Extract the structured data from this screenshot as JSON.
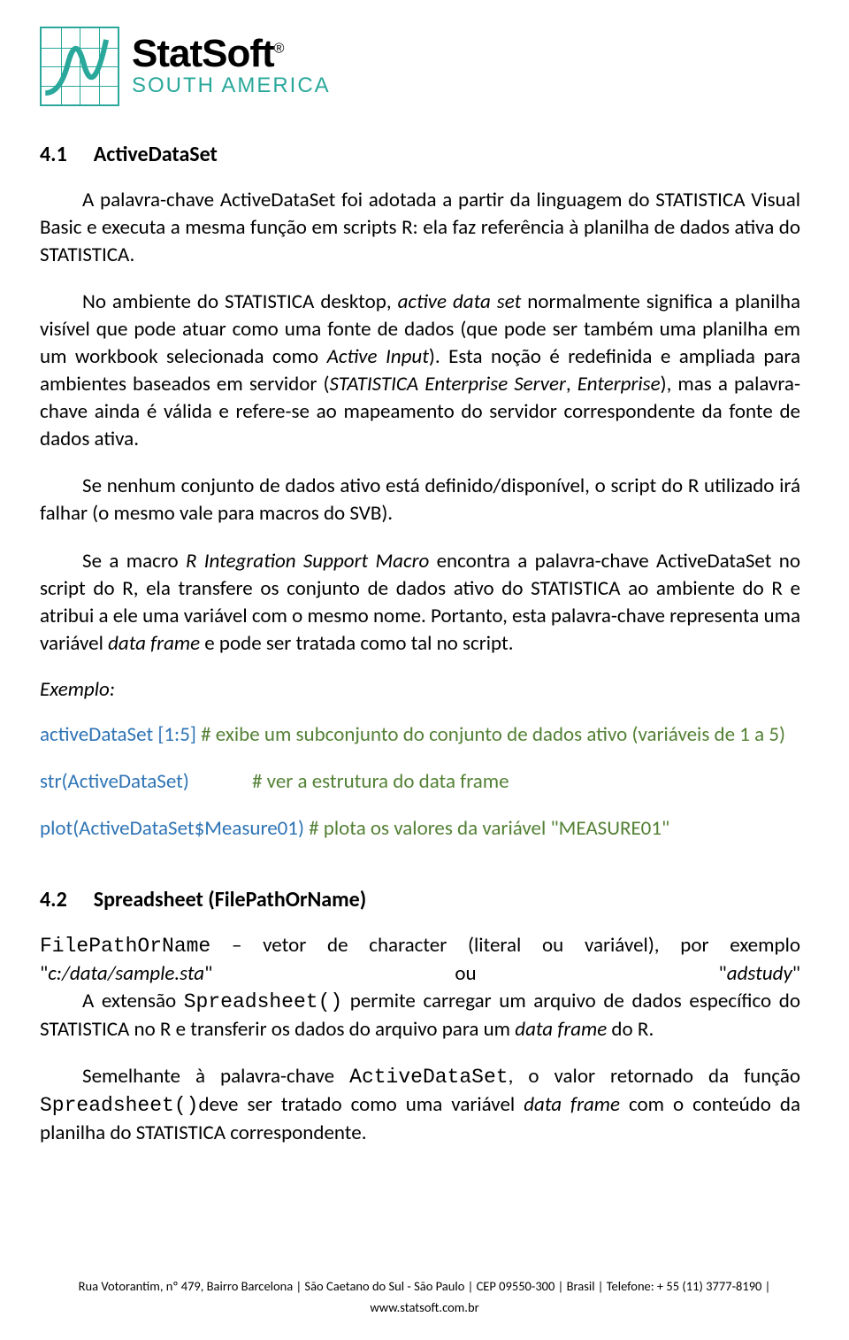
{
  "logo": {
    "brand": "StatSoft",
    "reg": "®",
    "subtitle": "SOUTH AMERICA"
  },
  "section1": {
    "number": "4.1",
    "title": "ActiveDataSet",
    "para1": "A palavra-chave ActiveDataSet foi adotada a partir da linguagem do STATISTICA Visual Basic e executa a mesma função em scripts R: ela faz referência à planilha de dados ativa do STATISTICA.",
    "para2_a": "No ambiente do STATISTICA desktop, ",
    "para2_b": "active data set",
    "para2_c": " normalmente significa a planilha visível que pode atuar como uma fonte de dados (que pode ser também uma planilha em um workbook selecionada como ",
    "para2_d": "Active Input",
    "para2_e": "). Esta noção é redefinida e ampliada para ambientes baseados em servidor (",
    "para2_f": "STATISTICA Enterprise Server",
    "para2_g": ", ",
    "para2_h": "Enterprise",
    "para2_i": "), mas a palavra-chave ainda é válida e refere-se ao mapeamento do servidor correspondente da fonte de dados ativa.",
    "para3": "Se nenhum conjunto de dados ativo está definido/disponível, o script do R utilizado irá falhar (o mesmo vale para macros do SVB).",
    "para4_a": "Se a macro ",
    "para4_b": "R Integration Support Macro",
    "para4_c": " encontra a palavra-chave ActiveDataSet no script do R, ela transfere os conjunto de dados ativo do STATISTICA ao ambiente do R e atribui a ele uma variável com o mesmo nome. Portanto, esta palavra-chave representa uma variável ",
    "para4_d": "data frame",
    "para4_e": " e pode ser tratada como tal no script.",
    "example_label": "Exemplo",
    "code1_blue": "activeDataSet [1:5]",
    "code1_green": " # exibe um subconjunto do conjunto de dados ativo (variáveis de 1 a 5)",
    "code2_blue": "str(ActiveDataSet)",
    "code2_green": "# ver a estrutura do data frame",
    "code3_blue": "plot(ActiveDataSet$Measure01)",
    "code3_green": " # plota os valores da variável \"MEASURE01\""
  },
  "section2": {
    "number": "4.2",
    "title": "Spreadsheet (FilePathOrName)",
    "para1_a": "FilePathOrName",
    "para1_b": " – vetor de character (literal ou variável), por exemplo \"",
    "para1_c": "c:/data/sample.sta",
    "para1_d": "\" ou \"",
    "para1_e": "adstudy",
    "para1_f": "\"",
    "para2_a": "A extensão ",
    "para2_b": "Spreadsheet()",
    "para2_c": " permite carregar um arquivo de dados específico do STATISTICA no R e transferir os dados do arquivo para um ",
    "para2_d": "data frame",
    "para2_e": " do R.",
    "para3_a": "Semelhante à palavra-chave ",
    "para3_b": "ActiveDataSet",
    "para3_c": ", o valor retornado da função ",
    "para3_d": "Spreadsheet()",
    "para3_e": "deve ser tratado como uma variável ",
    "para3_f": "data frame",
    "para3_g": " com o conteúdo da planilha do STATISTICA correspondente."
  },
  "footer": {
    "line1": "Rua Votorantim, nº 479, Bairro Barcelona | São Caetano do Sul - São Paulo | CEP 09550-300 | Brasil | Telefone: + 55 (11) 3777-8190 |",
    "line2": "www.statsoft.com.br"
  }
}
